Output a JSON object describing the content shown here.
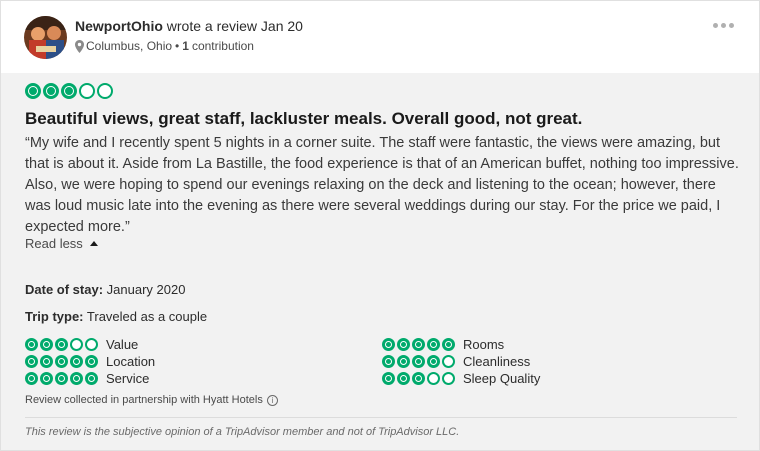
{
  "reviewer": {
    "name": "NewportOhio",
    "action": "wrote a review Jan 20",
    "location": "Columbus, Ohio",
    "separator": "•",
    "contributions_count": "1",
    "contributions_label": "contribution"
  },
  "review": {
    "rating": 3,
    "max_rating": 5,
    "title": "Beautiful views, great staff, lackluster meals. Overall good, not great.",
    "text": "“My wife and I recently spent 5 nights in a corner suite. The staff were fantastic, the views were amazing, but that is about it. Aside from La Bastille, the food experience is that of an American buffet, nothing too impressive. Also, we were hoping to spend our evenings relaxing on the deck and listening to the ocean; however, there was loud music late into the evening as there were several weddings during our stay. For the price we paid, I expected more.”",
    "read_less_label": "Read less",
    "date_of_stay_label": "Date of stay:",
    "date_of_stay_value": "January 2020",
    "trip_type_label": "Trip type:",
    "trip_type_value": "Traveled as a couple"
  },
  "sub_ratings": [
    {
      "label": "Value",
      "rating": 3
    },
    {
      "label": "Location",
      "rating": 5
    },
    {
      "label": "Service",
      "rating": 5
    },
    {
      "label": "Rooms",
      "rating": 5
    },
    {
      "label": "Cleanliness",
      "rating": 4
    },
    {
      "label": "Sleep Quality",
      "rating": 3
    }
  ],
  "footer": {
    "partnership": "Review collected in partnership with Hyatt Hotels",
    "disclaimer": "This review is the subjective opinion of a TripAdvisor member and not of TripAdvisor LLC."
  },
  "icons": {
    "avatar": "avatar-photo",
    "location": "map-pin-icon",
    "menu": "more-options-icon",
    "info": "info-icon",
    "caret": "caret-up-icon"
  },
  "colors": {
    "bubble": "#00aa6c",
    "body_bg": "#f2f2f2"
  }
}
